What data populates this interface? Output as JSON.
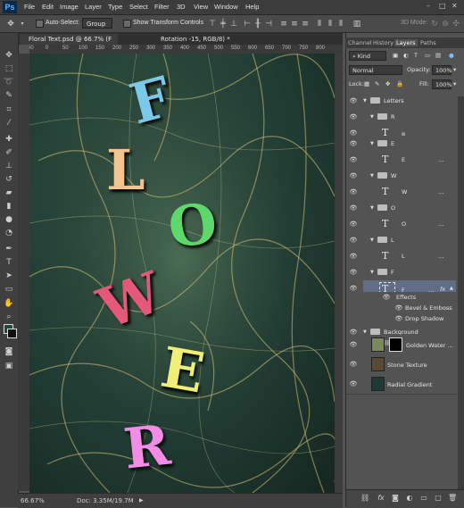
{
  "app": {
    "logo": "Ps"
  },
  "menu": [
    "File",
    "Edit",
    "Image",
    "Layer",
    "Type",
    "Select",
    "Filter",
    "3D",
    "View",
    "Window",
    "Help"
  ],
  "options": {
    "auto_select_label": "Auto-Select:",
    "auto_select_value": "Group",
    "show_transform_label": "Show Transform Controls",
    "mode_3d_label": "3D Mode:"
  },
  "document": {
    "tab_title": "Floral Text.psd @ 66.7% (F",
    "tab_title_right": "Rotation -15, RGB/8) *",
    "ruler_ticks": [
      "50",
      "0",
      "50",
      "100",
      "150",
      "200",
      "250",
      "300",
      "350",
      "400",
      "450",
      "500",
      "550",
      "600",
      "650",
      "700",
      "750",
      "800"
    ],
    "zoom": "66.67%",
    "doc_size": "Doc: 3.35M/19.7M"
  },
  "canvas_letters": [
    {
      "char": "F",
      "color": "#7cc8e8"
    },
    {
      "char": "L",
      "color": "#f3c48e"
    },
    {
      "char": "O",
      "color": "#5dd86a"
    },
    {
      "char": "W",
      "color": "#e4587a"
    },
    {
      "char": "E",
      "color": "#f0ee78"
    },
    {
      "char": "R",
      "color": "#f28ce6"
    }
  ],
  "panels": {
    "tabs": [
      "Channel",
      "History",
      "Layers",
      "Paths"
    ],
    "active_tab": "Layers",
    "filter_kind": "Kind",
    "blend_mode": "Normal",
    "opacity_label": "Opacity:",
    "opacity_value": "100%",
    "lock_label": "Lock:",
    "fill_label": "Fill:",
    "fill_value": "100%"
  },
  "layers": [
    {
      "type": "group",
      "name": "Letters",
      "indent": 0
    },
    {
      "type": "group",
      "name": "R",
      "indent": 1
    },
    {
      "type": "text",
      "name": "R",
      "indent": 2
    },
    {
      "type": "group",
      "name": "E",
      "indent": 1
    },
    {
      "type": "text",
      "name": "E",
      "indent": 2
    },
    {
      "type": "group",
      "name": "W",
      "indent": 1
    },
    {
      "type": "text",
      "name": "W",
      "indent": 2
    },
    {
      "type": "group",
      "name": "O",
      "indent": 1
    },
    {
      "type": "text",
      "name": "O",
      "indent": 2
    },
    {
      "type": "group",
      "name": "L",
      "indent": 1
    },
    {
      "type": "text",
      "name": "L",
      "indent": 2
    },
    {
      "type": "group",
      "name": "F",
      "indent": 1
    },
    {
      "type": "text-selected",
      "name": "F",
      "indent": 2,
      "fx": "fx"
    },
    {
      "type": "effects",
      "name": "Effects"
    },
    {
      "type": "effect",
      "name": "Bevel & Emboss"
    },
    {
      "type": "effect",
      "name": "Drop Shadow"
    },
    {
      "type": "group",
      "name": "Background",
      "indent": 0
    },
    {
      "type": "image",
      "name": "Golden Water ...",
      "indent": 1
    },
    {
      "type": "image",
      "name": "Stone Texture",
      "indent": 1
    },
    {
      "type": "image",
      "name": "Radial Gradient",
      "indent": 1
    }
  ]
}
